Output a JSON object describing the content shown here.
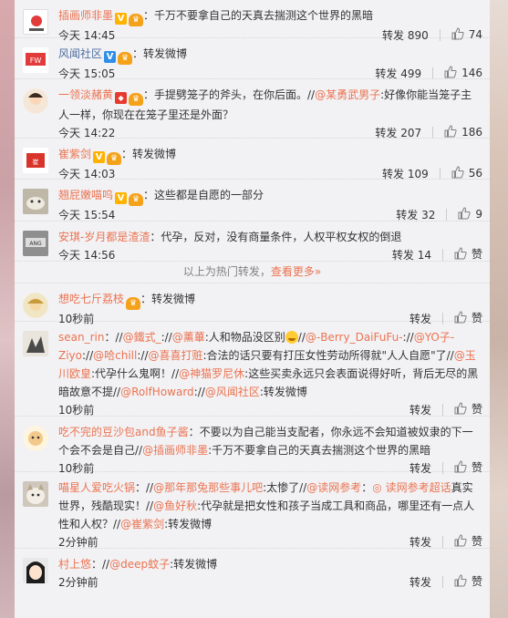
{
  "divider": {
    "text": "以上为热门转发，",
    "more": "查看更多»"
  },
  "comments": [
    {
      "user": "插画师非墨",
      "badges": [
        "vy",
        "vip"
      ],
      "segments": [
        {
          "t": "：千万不要拿自己的天真去揣测这个世界的黑暗",
          "c": ""
        }
      ],
      "time": "今天 14:45",
      "repost_label": "转发",
      "repost_count": "890",
      "like_count": "74"
    },
    {
      "user": "风闻社区",
      "user_color": "blue",
      "badges": [
        "vb",
        "vip"
      ],
      "segments": [
        {
          "t": "：转发微博",
          "c": ""
        }
      ],
      "time": "今天 15:05",
      "repost_label": "转发",
      "repost_count": "499",
      "like_count": "146"
    },
    {
      "user": "一领淡赭黄",
      "badges": [
        "red",
        "vip"
      ],
      "segments": [
        {
          "t": "：手提劈笼子的斧头，在你后面。//",
          "c": ""
        },
        {
          "t": "@某勇武男子",
          "c": "link"
        },
        {
          "t": ":好像你能当笼子主人一样，你现在在笼子里还是外面？",
          "c": ""
        }
      ],
      "time": "今天 14:22",
      "repost_label": "转发",
      "repost_count": "207",
      "like_count": "186"
    },
    {
      "user": "崔紫剑",
      "badges": [
        "vy",
        "vip"
      ],
      "segments": [
        {
          "t": "：转发微博",
          "c": ""
        }
      ],
      "time": "今天 14:03",
      "repost_label": "转发",
      "repost_count": "109",
      "like_count": "56"
    },
    {
      "user": "翘屁嫩喵呜",
      "badges": [
        "vy",
        "vip"
      ],
      "segments": [
        {
          "t": "：这些都是自愿的一部分",
          "c": ""
        }
      ],
      "time": "今天 15:54",
      "repost_label": "转发",
      "repost_count": "32",
      "like_count": "9"
    },
    {
      "user": "安琪-岁月都是渣渣",
      "badges": [],
      "segments": [
        {
          "t": "：代孕，反对，没有商量条件，人权平权女权的倒退",
          "c": ""
        }
      ],
      "time": "今天 14:56",
      "repost_label": "转发",
      "repost_count": "14",
      "like_count": "赞"
    },
    {
      "user": "想吃七斤荔枝",
      "badges": [
        "vip"
      ],
      "segments": [
        {
          "t": "：转发微博",
          "c": ""
        }
      ],
      "time": "10秒前",
      "repost_label": "转发",
      "repost_count": "",
      "like_count": "赞"
    },
    {
      "user": "sean_rin",
      "badges": [],
      "segments": [
        {
          "t": "：//",
          "c": ""
        },
        {
          "t": "@鐵式_",
          "c": "link"
        },
        {
          "t": "://",
          "c": ""
        },
        {
          "t": "@薰蓽",
          "c": "link"
        },
        {
          "t": ":人和物品没区别",
          "c": ""
        },
        {
          "t": "EMOJI",
          "c": "emoji"
        },
        {
          "t": "//",
          "c": ""
        },
        {
          "t": "@-Berry_DaiFuFu-",
          "c": "link"
        },
        {
          "t": "://",
          "c": ""
        },
        {
          "t": "@YO子-Ziyo",
          "c": "link"
        },
        {
          "t": "://",
          "c": ""
        },
        {
          "t": "@哈chill",
          "c": "link"
        },
        {
          "t": "://",
          "c": ""
        },
        {
          "t": "@喜喜打赃",
          "c": "link"
        },
        {
          "t": ":合法的话只要有打压女性劳动所得就\"人人自愿\"了//",
          "c": ""
        },
        {
          "t": "@玉川欧皇",
          "c": "link"
        },
        {
          "t": ":代孕什么鬼啊！//",
          "c": ""
        },
        {
          "t": "@神猫罗尼休",
          "c": "link"
        },
        {
          "t": ":这些买卖永远只会表面说得好听，背后无尽的黑暗故意不提//",
          "c": ""
        },
        {
          "t": "@RolfHoward",
          "c": "link"
        },
        {
          "t": "://",
          "c": ""
        },
        {
          "t": "@风闻社区",
          "c": "link"
        },
        {
          "t": ":转发微博",
          "c": ""
        }
      ],
      "time": "10秒前",
      "repost_label": "转发",
      "repost_count": "",
      "like_count": "赞"
    },
    {
      "user": "吃不完的豆沙包and鱼子酱",
      "badges": [],
      "segments": [
        {
          "t": "：不要以为自己能当支配者，你永远不会知道被奴隶的下一个会不会是自己//",
          "c": ""
        },
        {
          "t": "@插画师非墨",
          "c": "link"
        },
        {
          "t": ":千万不要拿自己的天真去揣测这个世界的黑暗",
          "c": ""
        }
      ],
      "time": "10秒前",
      "repost_label": "转发",
      "repost_count": "",
      "like_count": "赞"
    },
    {
      "user": "喵星人爱吃火锅",
      "badges": [],
      "segments": [
        {
          "t": "：//",
          "c": ""
        },
        {
          "t": "@那年那兔那些事儿吧",
          "c": "link"
        },
        {
          "t": ":太惨了//",
          "c": ""
        },
        {
          "t": "@读网参考",
          "c": "link"
        },
        {
          "t": "：",
          "c": ""
        },
        {
          "t": "◎ 读网参考超话",
          "c": "link"
        },
        {
          "t": "真实世界，残酷现实！//",
          "c": ""
        },
        {
          "t": "@鱼好秋",
          "c": "link"
        },
        {
          "t": ":代孕就是把女性和孩子当成工具和商品，哪里还有一点人性和人权？//",
          "c": ""
        },
        {
          "t": "@崔紫剑",
          "c": "link"
        },
        {
          "t": ":转发微博",
          "c": ""
        }
      ],
      "time": "2分钟前",
      "repost_label": "转发",
      "repost_count": "",
      "like_count": "赞"
    },
    {
      "user": "村上悠",
      "badges": [],
      "segments": [
        {
          "t": "：//",
          "c": ""
        },
        {
          "t": "@deep蚊子",
          "c": "link"
        },
        {
          "t": ":转发微博",
          "c": ""
        }
      ],
      "time": "2分钟前",
      "repost_label": "转发",
      "repost_count": "",
      "like_count": "赞"
    }
  ],
  "colors": {
    "link": "#eb7350",
    "panel": "#f2f2f5"
  }
}
